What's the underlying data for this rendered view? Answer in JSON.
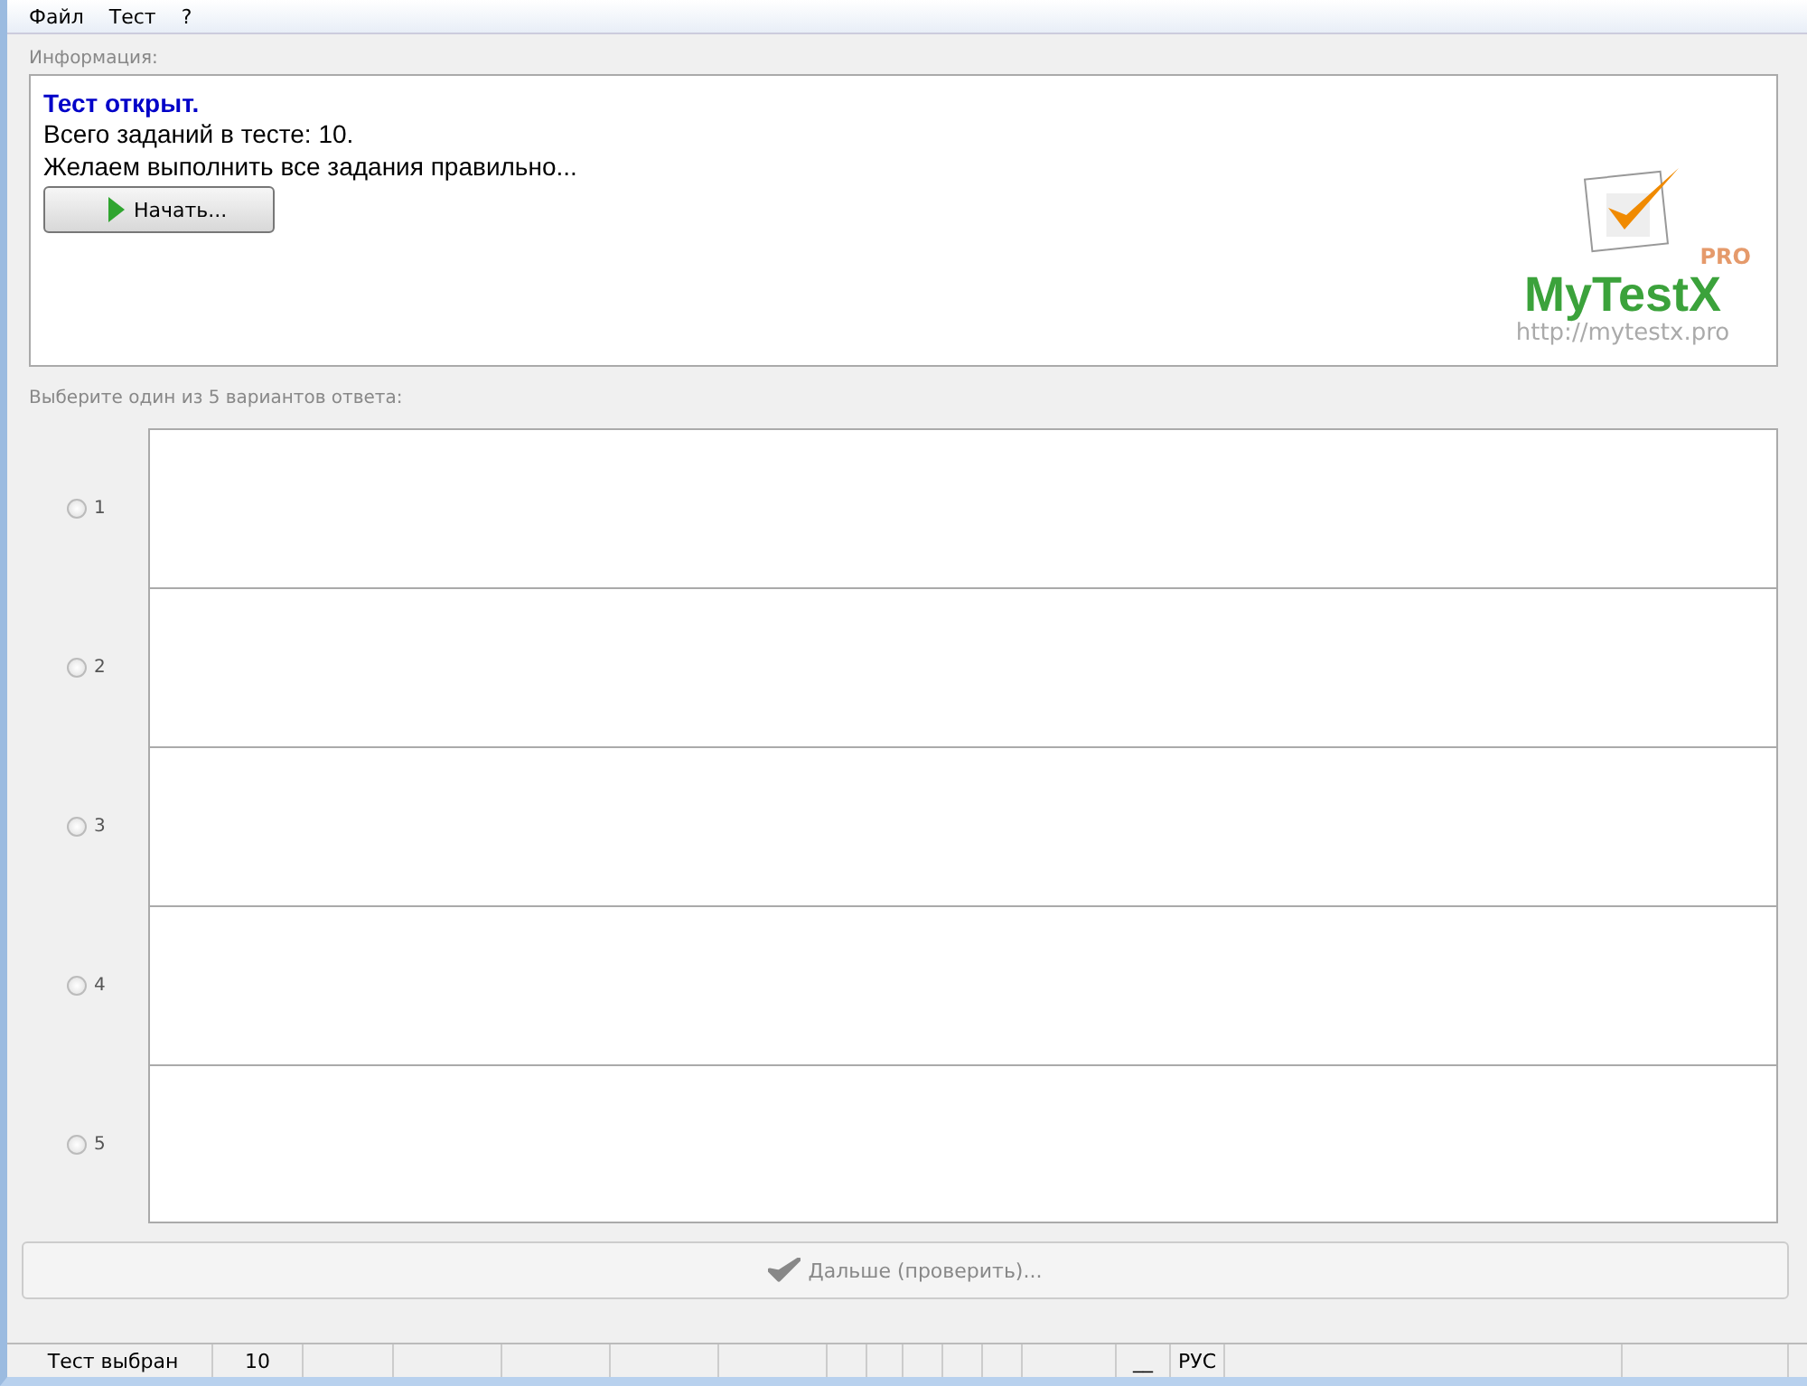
{
  "menu": [
    "Файл",
    "Тест",
    "?"
  ],
  "info": {
    "label": "Информация:",
    "title": "Тест открыт.",
    "lines": [
      "Всего заданий в тесте: 10.",
      "Желаем выполнить все задания правильно..."
    ],
    "start_button": "Начать...",
    "logo": {
      "badge": "PRO",
      "name": "MyTestX",
      "url": "http://mytestx.pro"
    }
  },
  "prompt": "Выберите один из 5 вариантов ответа:",
  "answers": [
    {
      "number": "1",
      "selected": false
    },
    {
      "number": "2",
      "selected": false
    },
    {
      "number": "3",
      "selected": false
    },
    {
      "number": "4",
      "selected": false
    },
    {
      "number": "5",
      "selected": false
    }
  ],
  "next_button": {
    "label": "Дальше (проверить)...",
    "disabled": true
  },
  "status_bar": [
    {
      "text": "Тест выбран",
      "kind": "text"
    },
    {
      "text": "10",
      "kind": "text"
    },
    {
      "kind": "blank"
    },
    {
      "kind": "blank"
    },
    {
      "kind": "blank"
    },
    {
      "kind": "blank"
    },
    {
      "kind": "blank"
    },
    {
      "kind": "blank"
    },
    {
      "kind": "blank"
    },
    {
      "kind": "blank"
    },
    {
      "kind": "blank"
    },
    {
      "kind": "blank"
    },
    {
      "kind": "blank"
    },
    {
      "text": "__",
      "kind": "text"
    },
    {
      "text": "РУС",
      "kind": "text"
    },
    {
      "kind": "blank"
    },
    {
      "kind": "blank"
    }
  ]
}
